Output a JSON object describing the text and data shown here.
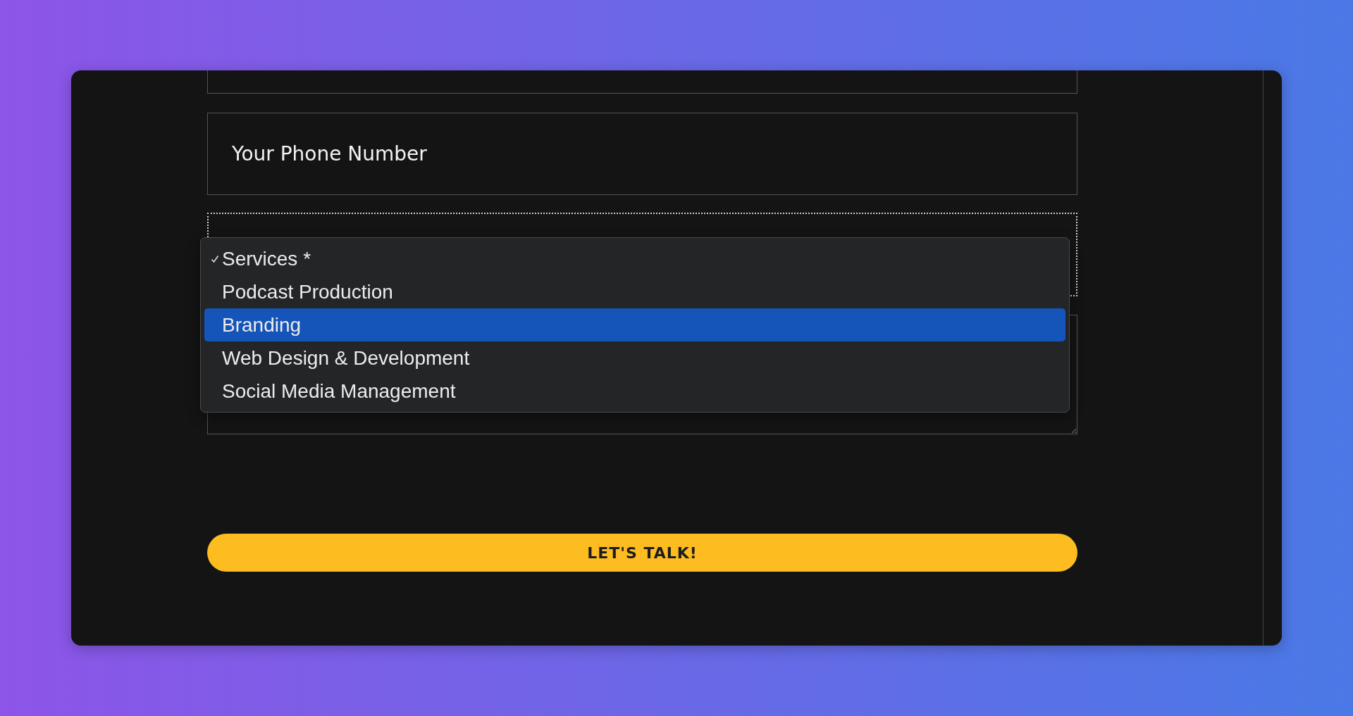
{
  "form": {
    "fields": [
      {
        "kind": "input"
      },
      {
        "kind": "input",
        "placeholder": "Your Phone Number"
      },
      {
        "kind": "select",
        "options": [
          {
            "label": "Services *",
            "checked": true,
            "selected": false
          },
          {
            "label": "Podcast Production",
            "checked": false,
            "selected": false
          },
          {
            "label": "Branding",
            "checked": false,
            "selected": true
          },
          {
            "label": "Web Design & Development",
            "checked": false,
            "selected": false
          },
          {
            "label": "Social Media Management",
            "checked": false,
            "selected": false
          }
        ]
      },
      {
        "kind": "textarea"
      }
    ],
    "submit": {
      "label": "LET'S TALK!"
    }
  }
}
